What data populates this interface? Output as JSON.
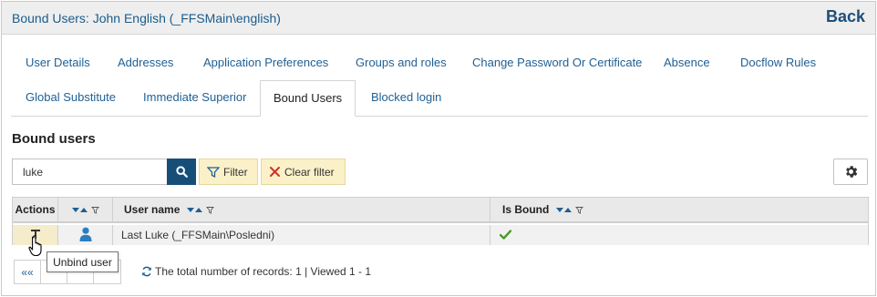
{
  "header": {
    "title": "Bound Users: John English (_FFSMain\\english)",
    "back_label": "Back"
  },
  "tabs": [
    {
      "label": "User Details"
    },
    {
      "label": "Addresses"
    },
    {
      "label": "Application Preferences"
    },
    {
      "label": "Groups and roles"
    },
    {
      "label": "Change Password Or Certificate"
    },
    {
      "label": "Absence"
    },
    {
      "label": "Docflow Rules"
    },
    {
      "label": "Global Substitute"
    },
    {
      "label": "Immediate Superior"
    },
    {
      "label": "Bound Users",
      "active": true
    },
    {
      "label": "Blocked login"
    }
  ],
  "section_title": "Bound users",
  "search": {
    "value": "luke",
    "icon": "search-icon"
  },
  "filter_label": "Filter",
  "clear_filter_label": "Clear filter",
  "grid": {
    "columns": [
      "Actions",
      "",
      "User name",
      "Is Bound"
    ],
    "rows": [
      {
        "user_name": "Last Luke (_FFSMain\\Posledni)",
        "is_bound": true
      }
    ]
  },
  "pager": {
    "first_label": "««"
  },
  "records_text": "The total number of records: 1 | Viewed 1 - 1",
  "tooltip": "Unbind user",
  "colors": {
    "accent": "#164e78",
    "link": "#1f5f93",
    "filter_bg": "#fbf1c8",
    "check": "#4a9a2a",
    "person": "#2b7fc0"
  }
}
